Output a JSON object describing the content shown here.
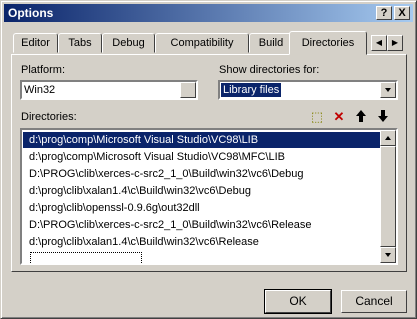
{
  "window": {
    "title": "Options",
    "help_glyph": "?",
    "close_glyph": "X"
  },
  "tabs": [
    {
      "label": "Editor"
    },
    {
      "label": "Tabs"
    },
    {
      "label": "Debug"
    },
    {
      "label": "Compatibility"
    },
    {
      "label": "Build"
    },
    {
      "label": "Directories",
      "active": true
    }
  ],
  "tab_scroll": {
    "left": "◀",
    "right": "▶"
  },
  "platform": {
    "label": "Platform:",
    "value": "Win32"
  },
  "show_dirs": {
    "label": "Show directories for:",
    "value": "Library files"
  },
  "directories": {
    "label": "Directories:",
    "items": [
      "d:\\prog\\comp\\Microsoft Visual Studio\\VC98\\LIB",
      "d:\\prog\\comp\\Microsoft Visual Studio\\VC98\\MFC\\LIB",
      "D:\\PROG\\clib\\xerces-c-src2_1_0\\Build\\win32\\vc6\\Debug",
      "d:\\prog\\clib\\xalan1.4\\c\\Build\\win32\\vc6\\Debug",
      "d:\\prog\\clib\\openssl-0.9.6g\\out32dll",
      "D:\\PROG\\clib\\xerces-c-src2_1_0\\Build\\win32\\vc6\\Release",
      "d:\\prog\\clib\\xalan1.4\\c\\Build\\win32\\vc6\\Release"
    ],
    "selected_index": 0
  },
  "toolbar": {
    "new": "⬚",
    "delete": "✕",
    "up": "🡑",
    "down": "🡓"
  },
  "buttons": {
    "ok": "OK",
    "cancel": "Cancel"
  },
  "colors": {
    "selection": "#0a246a",
    "face": "#d4d0c8",
    "delete": "#c00000"
  }
}
